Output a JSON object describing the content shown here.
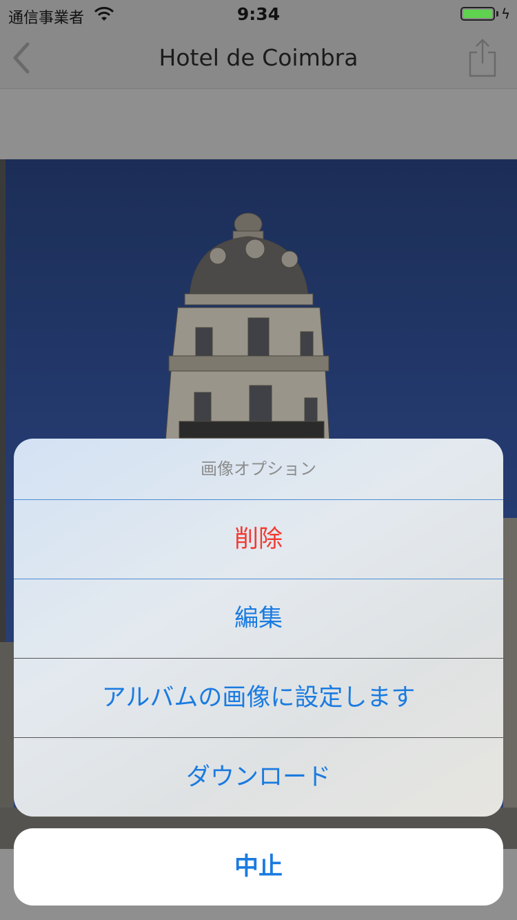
{
  "status_bar": {
    "carrier": "通信事業者",
    "time": "9:34",
    "battery_level": 1.0
  },
  "nav": {
    "title": "Hotel de Coimbra",
    "back_icon": "chevron-left-icon",
    "share_icon": "share-icon"
  },
  "action_sheet": {
    "title": "画像オプション",
    "options": [
      {
        "label": "削除",
        "style": "destructive"
      },
      {
        "label": "編集",
        "style": "default"
      },
      {
        "label": "アルバムの画像に設定します",
        "style": "default"
      },
      {
        "label": "ダウンロード",
        "style": "default"
      }
    ],
    "cancel_label": "中止"
  },
  "colors": {
    "accent": "#1a7be0",
    "destructive": "#f23a30",
    "battery": "#5fd34f"
  }
}
